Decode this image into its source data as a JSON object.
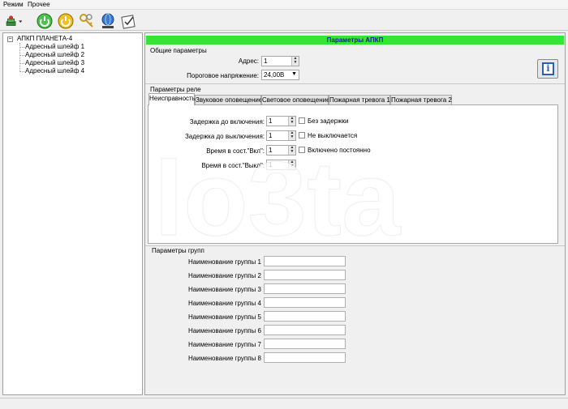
{
  "menu": {
    "items": [
      {
        "label": "Режим"
      },
      {
        "label": "Прочее"
      }
    ]
  },
  "tree": {
    "root": "АПКП ПЛАНЕТА-4",
    "items": [
      {
        "label": "Адресный шлейф 1"
      },
      {
        "label": "Адресный шлейф 2"
      },
      {
        "label": "Адресный шлейф 3"
      },
      {
        "label": "Адресный шлейф 4"
      }
    ]
  },
  "panel": {
    "title": "Параметры АПКП",
    "general": {
      "title": "Общие параметры",
      "address_label": "Адрес:",
      "address_value": "1",
      "voltage_label": "Пороговое напряжение:",
      "voltage_value": "24,00В"
    },
    "relay": {
      "title": "Параметры реле",
      "tabs": [
        {
          "label": "Неисправность"
        },
        {
          "label": "Звуковое оповещение"
        },
        {
          "label": "Световое оповещение"
        },
        {
          "label": "Пожарная тревога 1"
        },
        {
          "label": "Пожарная тревога 2"
        }
      ],
      "fields": [
        {
          "label": "Задержка до включения:",
          "value": "1",
          "check": "Без задержки"
        },
        {
          "label": "Задержка до выключения:",
          "value": "1",
          "check": "Не выключается"
        },
        {
          "label": "Время в сост.\"Вкл\":",
          "value": "1",
          "check": "Включено постоянно"
        },
        {
          "label": "Время в сост.\"Выкл\":",
          "value": "1"
        }
      ]
    },
    "groups": {
      "title": "Параметры групп",
      "items": [
        {
          "label": "Наименование группы 1",
          "value": ""
        },
        {
          "label": "Наименование группы 2",
          "value": ""
        },
        {
          "label": "Наименование группы 3",
          "value": ""
        },
        {
          "label": "Наименование группы 4",
          "value": ""
        },
        {
          "label": "Наименование группы 5",
          "value": ""
        },
        {
          "label": "Наименование группы 6",
          "value": ""
        },
        {
          "label": "Наименование группы 7",
          "value": ""
        },
        {
          "label": "Наименование группы 8",
          "value": ""
        }
      ]
    }
  },
  "toolbar": {
    "buttons": [
      {
        "icon": "device-stack-icon"
      },
      {
        "icon": "power-green-icon"
      },
      {
        "icon": "power-yellow-icon"
      },
      {
        "icon": "keys-icon"
      },
      {
        "icon": "globe-monitor-icon"
      },
      {
        "icon": "checklist-icon"
      }
    ]
  },
  "colors": {
    "header_bg": "#33e633",
    "header_text": "#1a1a9a",
    "info_accent": "#2b5fb8"
  },
  "watermark": "lo3ta"
}
